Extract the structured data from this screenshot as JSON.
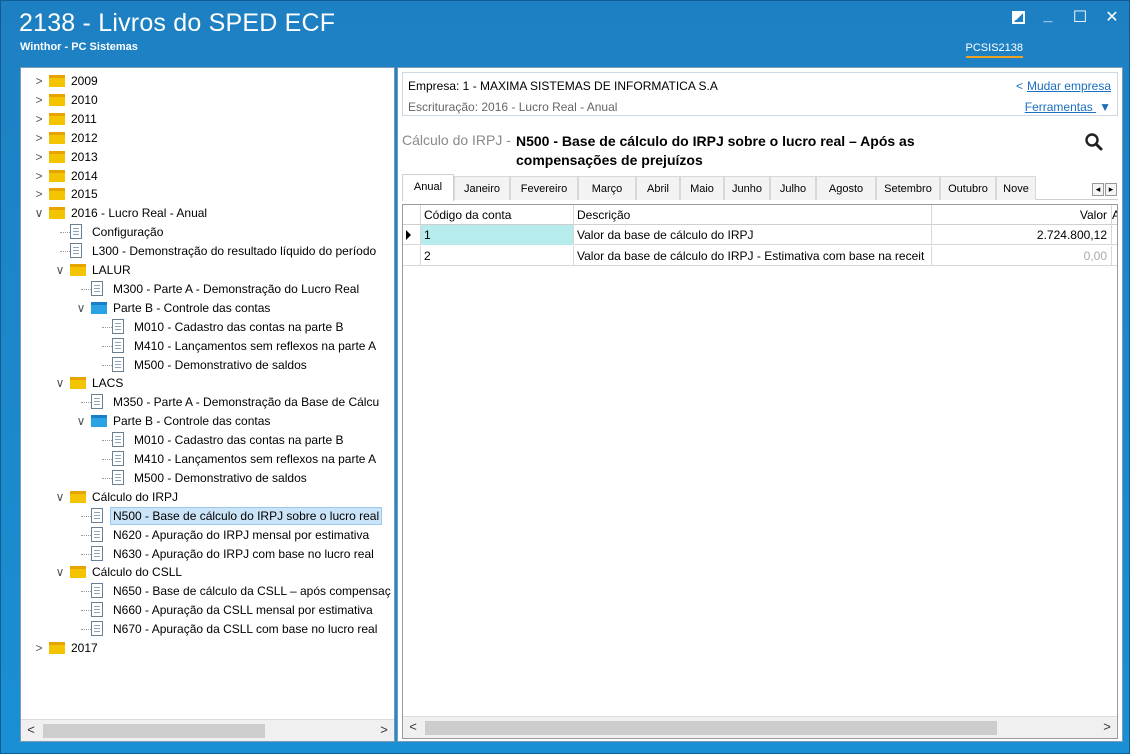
{
  "window": {
    "title": "2138 - Livros do SPED ECF",
    "subtitle": "Winthor - PC Sistemas",
    "program_code": "PCSIS2138",
    "controls": [
      "restore-icon",
      "minimize-icon",
      "maximize-icon",
      "close-icon"
    ]
  },
  "tree": {
    "items": [
      {
        "label": "2009",
        "type": "folder"
      },
      {
        "label": "2010",
        "type": "folder"
      },
      {
        "label": "2011",
        "type": "folder"
      },
      {
        "label": "2012",
        "type": "folder"
      },
      {
        "label": "2013",
        "type": "folder"
      },
      {
        "label": "2014",
        "type": "folder"
      },
      {
        "label": "2015",
        "type": "folder"
      },
      {
        "label": "2016 - Lucro Real - Anual",
        "type": "folder",
        "expanded": true
      },
      {
        "label": "Configuração",
        "type": "doc"
      },
      {
        "label": "L300 - Demonstração do resultado líquido do período",
        "type": "doc"
      },
      {
        "label": "LALUR",
        "type": "folder",
        "expanded": true
      },
      {
        "label": "M300 - Parte A - Demonstração do Lucro Real",
        "type": "doc"
      },
      {
        "label": "Parte B - Controle das contas",
        "type": "folder-blue",
        "expanded": true
      },
      {
        "label": "M010 - Cadastro das contas na parte B",
        "type": "doc"
      },
      {
        "label": "M410 - Lançamentos sem reflexos na parte A",
        "type": "doc"
      },
      {
        "label": "M500 - Demonstrativo de saldos",
        "type": "doc"
      },
      {
        "label": "LACS",
        "type": "folder",
        "expanded": true
      },
      {
        "label": "M350 - Parte A - Demonstração da Base de Cálcu",
        "type": "doc"
      },
      {
        "label": "Parte B - Controle das contas",
        "type": "folder-blue",
        "expanded": true
      },
      {
        "label": "M010 - Cadastro das contas na parte B",
        "type": "doc"
      },
      {
        "label": "M410 - Lançamentos sem reflexos na parte A",
        "type": "doc"
      },
      {
        "label": "M500 - Demonstrativo de saldos",
        "type": "doc"
      },
      {
        "label": "Cálculo do IRPJ",
        "type": "folder",
        "expanded": true
      },
      {
        "label": "N500 - Base de cálculo do IRPJ sobre o lucro real",
        "type": "doc",
        "selected": true
      },
      {
        "label": "N620 - Apuração do IRPJ mensal por estimativa",
        "type": "doc"
      },
      {
        "label": "N630 - Apuração do IRPJ com base no lucro real",
        "type": "doc"
      },
      {
        "label": "Cálculo do CSLL",
        "type": "folder",
        "expanded": true
      },
      {
        "label": "N650 - Base de cálculo da CSLL – após compensaç",
        "type": "doc"
      },
      {
        "label": "N660 - Apuração da CSLL mensal por estimativa",
        "type": "doc"
      },
      {
        "label": "N670 - Apuração da CSLL com base no lucro real",
        "type": "doc"
      },
      {
        "label": "2017",
        "type": "folder"
      }
    ]
  },
  "header": {
    "company": "Empresa: 1 - MAXIMA SISTEMAS DE INFORMATICA S.A",
    "escrituracao": "Escrituração: 2016 - Lucro Real - Anual",
    "change_company": "Mudar empresa",
    "change_company_prefix": "<",
    "tools": "Ferramentas",
    "tools_arrow": "▼"
  },
  "section": {
    "prefix": "Cálculo do IRPJ -",
    "title": "N500 - Base de cálculo do IRPJ sobre o lucro real – Após as compensações de prejuízos"
  },
  "tabs": [
    "Anual",
    "Janeiro",
    "Fevereiro",
    "Março",
    "Abril",
    "Maio",
    "Junho",
    "Julho",
    "Agosto",
    "Setembro",
    "Outubro",
    "Nove"
  ],
  "grid": {
    "columns": [
      "Código da conta",
      "Descrição",
      "Valor",
      "A"
    ],
    "rows": [
      {
        "code": "1",
        "description": "Valor da base de cálculo do IRPJ",
        "value": "2.724.800,12"
      },
      {
        "code": "2",
        "description": "Valor da base de cálculo do IRPJ - Estimativa com base na receit",
        "value": "0,00"
      }
    ]
  },
  "colors": {
    "title_bg": "#1d80c2",
    "accent_underline": "#f0a020",
    "selected_row": "#b6ecec",
    "link": "#1a6fc0",
    "folder": "#f4c400",
    "folder_blue": "#2aa2e6"
  }
}
